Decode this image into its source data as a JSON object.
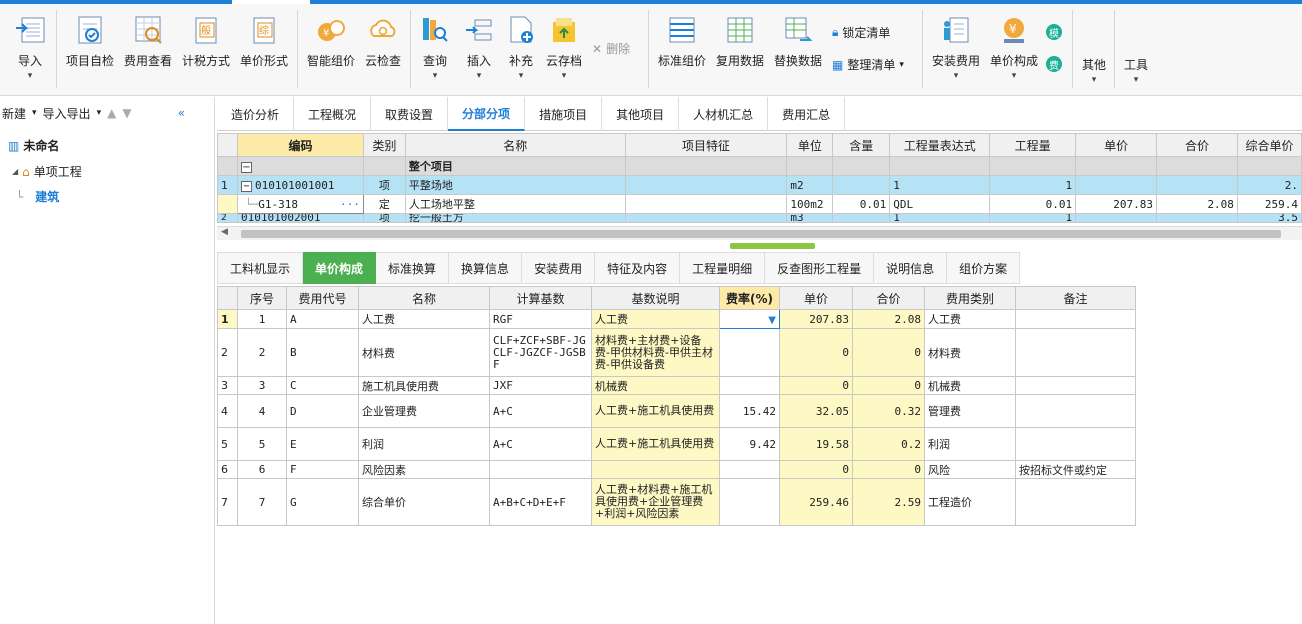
{
  "ribbon": {
    "import": "导入",
    "self_check": "项目自检",
    "fee_view": "费用查看",
    "tax_mode": "计税方式",
    "price_form": "单价形式",
    "smart_price": "智能组价",
    "cloud_check": "云检查",
    "query": "查询",
    "insert": "插入",
    "supplement": "补充",
    "cloud_save": "云存档",
    "delete": "删除",
    "std_price": "标准组价",
    "reuse_data": "复用数据",
    "replace_data": "替换数据",
    "lock_list": "锁定清单",
    "organize_list": "整理清单",
    "install_fee": "安装费用",
    "price_compose": "单价构成",
    "badge_mo": "模",
    "badge_fee": "费",
    "other": "其他",
    "tools": "工具"
  },
  "left": {
    "new": "新建",
    "import_export": "导入导出",
    "project": "未命名",
    "unit_project": "单项工程",
    "building": "建筑"
  },
  "tabs": [
    "造价分析",
    "工程概况",
    "取费设置",
    "分部分项",
    "措施项目",
    "其他项目",
    "人材机汇总",
    "费用汇总"
  ],
  "grid1": {
    "headers": [
      "编码",
      "类别",
      "名称",
      "项目特征",
      "单位",
      "含量",
      "工程量表达式",
      "工程量",
      "单价",
      "合价",
      "综合单价"
    ],
    "rows": [
      {
        "no": "",
        "code": "",
        "type": "",
        "name": "整个项目",
        "feat": "",
        "unit": "",
        "content": "",
        "expr": "",
        "qty": "",
        "price": "",
        "total": "",
        "unit_price": ""
      },
      {
        "no": "1",
        "code": "010101001001",
        "type": "项",
        "name": "平整场地",
        "feat": "",
        "unit": "m2",
        "content": "",
        "expr": "1",
        "qty": "1",
        "price": "",
        "total": "",
        "unit_price": "2."
      },
      {
        "no": "",
        "code": "G1-318",
        "type": "定",
        "name": "人工场地平整",
        "feat": "",
        "unit": "100m2",
        "content": "0.01",
        "expr": "QDL",
        "qty": "0.01",
        "price": "207.83",
        "total": "2.08",
        "unit_price": "259.4"
      },
      {
        "no": "2",
        "code": "010101002001",
        "type": "项",
        "name": "挖一般土方",
        "feat": "",
        "unit": "m3",
        "content": "",
        "expr": "1",
        "qty": "1",
        "price": "",
        "total": "",
        "unit_price": "3.5"
      }
    ]
  },
  "tabs2": [
    "工料机显示",
    "单价构成",
    "标准换算",
    "换算信息",
    "安装费用",
    "特征及内容",
    "工程量明细",
    "反查图形工程量",
    "说明信息",
    "组价方案"
  ],
  "grid2": {
    "headers": [
      "序号",
      "费用代号",
      "名称",
      "计算基数",
      "基数说明",
      "费率(%)",
      "单价",
      "合价",
      "费用类别",
      "备注"
    ],
    "rows": [
      {
        "idx": "1",
        "seq": "1",
        "code": "A",
        "name": "人工费",
        "base": "RGF",
        "desc": "人工费",
        "rate": "",
        "price": "207.83",
        "total": "2.08",
        "cat": "人工费",
        "note": ""
      },
      {
        "idx": "2",
        "seq": "2",
        "code": "B",
        "name": "材料费",
        "base": "CLF+ZCF+SBF-JGCLF-JGZCF-JGSBF",
        "desc": "材料费+主材费+设备费-甲供材料费-甲供主材费-甲供设备费",
        "rate": "",
        "price": "0",
        "total": "0",
        "cat": "材料费",
        "note": ""
      },
      {
        "idx": "3",
        "seq": "3",
        "code": "C",
        "name": "施工机具使用费",
        "base": "JXF",
        "desc": "机械费",
        "rate": "",
        "price": "0",
        "total": "0",
        "cat": "机械费",
        "note": ""
      },
      {
        "idx": "4",
        "seq": "4",
        "code": "D",
        "name": "企业管理费",
        "base": "A+C",
        "desc": "人工费+施工机具使用费",
        "rate": "15.42",
        "price": "32.05",
        "total": "0.32",
        "cat": "管理费",
        "note": ""
      },
      {
        "idx": "5",
        "seq": "5",
        "code": "E",
        "name": "利润",
        "base": "A+C",
        "desc": "人工费+施工机具使用费",
        "rate": "9.42",
        "price": "19.58",
        "total": "0.2",
        "cat": "利润",
        "note": ""
      },
      {
        "idx": "6",
        "seq": "6",
        "code": "F",
        "name": "风险因素",
        "base": "",
        "desc": "",
        "rate": "",
        "price": "0",
        "total": "0",
        "cat": "风险",
        "note": "按招标文件或约定"
      },
      {
        "idx": "7",
        "seq": "7",
        "code": "G",
        "name": "综合单价",
        "base": "A+B+C+D+E+F",
        "desc": "人工费+材料费+施工机具使用费+企业管理费+利润+风险因素",
        "rate": "",
        "price": "259.46",
        "total": "2.59",
        "cat": "工程造价",
        "note": ""
      }
    ]
  }
}
